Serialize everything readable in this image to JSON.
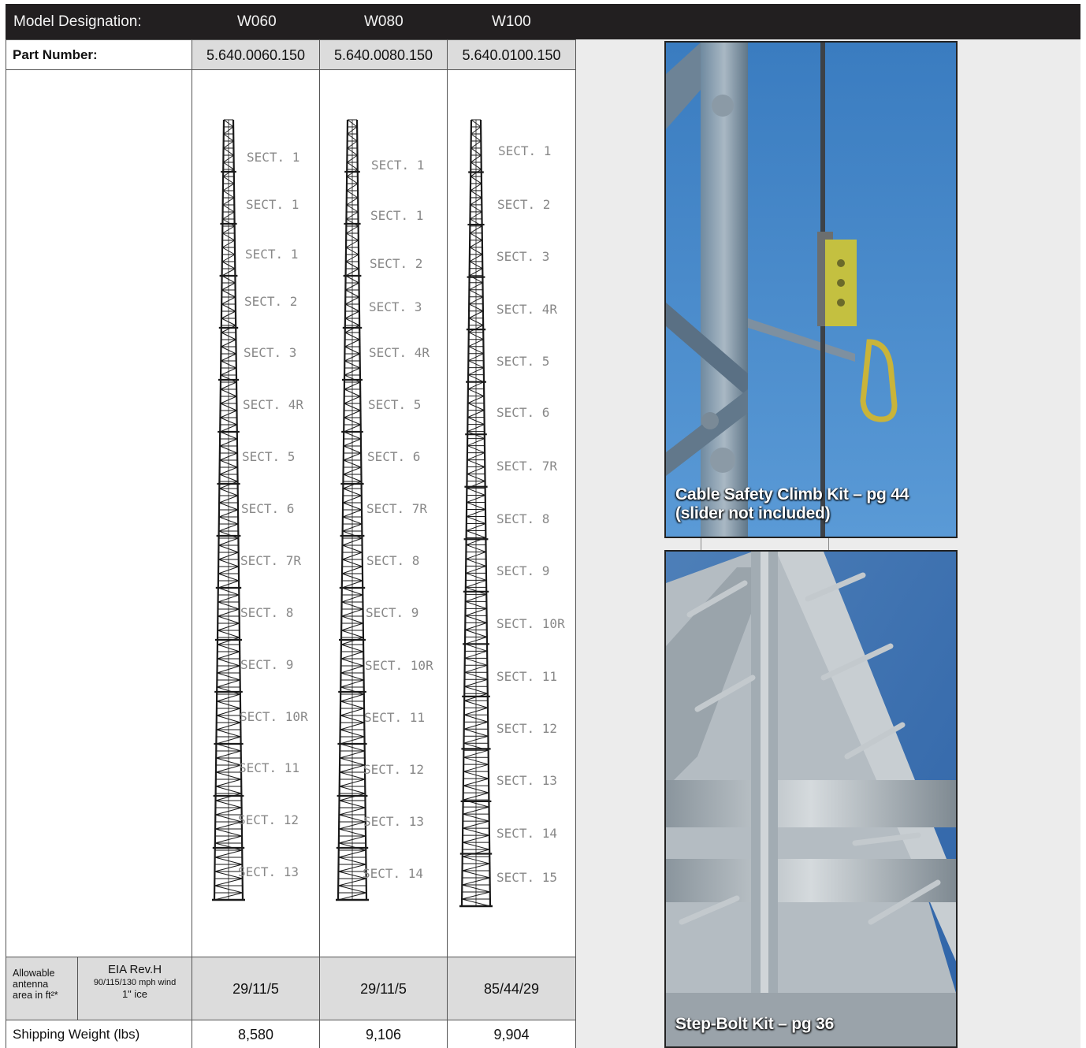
{
  "header": {
    "label": "Model Designation:",
    "models": [
      "W060",
      "W080",
      "W100"
    ]
  },
  "part_number": {
    "label": "Part Number:",
    "values": [
      "5.640.0060.150",
      "5.640.0080.150",
      "5.640.0100.150"
    ]
  },
  "towers": [
    {
      "model": "W060",
      "sections": [
        "SECT. 1",
        "SECT. 1",
        "SECT. 1",
        "SECT. 2",
        "SECT. 3",
        "SECT. 4R",
        "SECT. 5",
        "SECT. 6",
        "SECT. 7R",
        "SECT. 8",
        "SECT. 9",
        "SECT. 10R",
        "SECT. 11",
        "SECT. 12",
        "SECT. 13"
      ]
    },
    {
      "model": "W080",
      "sections": [
        "SECT. 1",
        "SECT. 1",
        "SECT. 2",
        "SECT. 3",
        "SECT. 4R",
        "SECT. 5",
        "SECT. 6",
        "SECT. 7R",
        "SECT. 8",
        "SECT. 9",
        "SECT. 10R",
        "SECT. 11",
        "SECT. 12",
        "SECT. 13",
        "SECT. 14"
      ]
    },
    {
      "model": "W100",
      "sections": [
        "SECT. 1",
        "SECT. 2",
        "SECT. 3",
        "SECT. 4R",
        "SECT. 5",
        "SECT. 6",
        "SECT. 7R",
        "SECT. 8",
        "SECT. 9",
        "SECT. 10R",
        "SECT. 11",
        "SECT. 12",
        "SECT. 13",
        "SECT. 14",
        "SECT. 15"
      ]
    }
  ],
  "antenna": {
    "label_line1": "Allowable",
    "label_line2": "antenna",
    "label_line3": "area in ft²*",
    "eia_title": "EIA Rev.H",
    "eia_wind": "90/115/130 mph wind",
    "eia_ice": "1\" ice",
    "values": [
      "29/11/5",
      "29/11/5",
      "85/44/29"
    ]
  },
  "shipping": {
    "label": "Shipping Weight (lbs)",
    "values": [
      "8,580",
      "9,106",
      "9,904"
    ]
  },
  "photos": {
    "cable_caption_line1": "Cable Safety Climb Kit – pg 44",
    "cable_caption_line2": "(slider not included)",
    "stepbolt_caption": "Step-Bolt Kit – pg 36"
  },
  "colors": {
    "header_bg": "#221f20",
    "header_text": "#f4f4f4",
    "cell_gray": "#dcdcdc",
    "panel_gray": "#ececec",
    "sky_blue": "#3f86c9"
  }
}
